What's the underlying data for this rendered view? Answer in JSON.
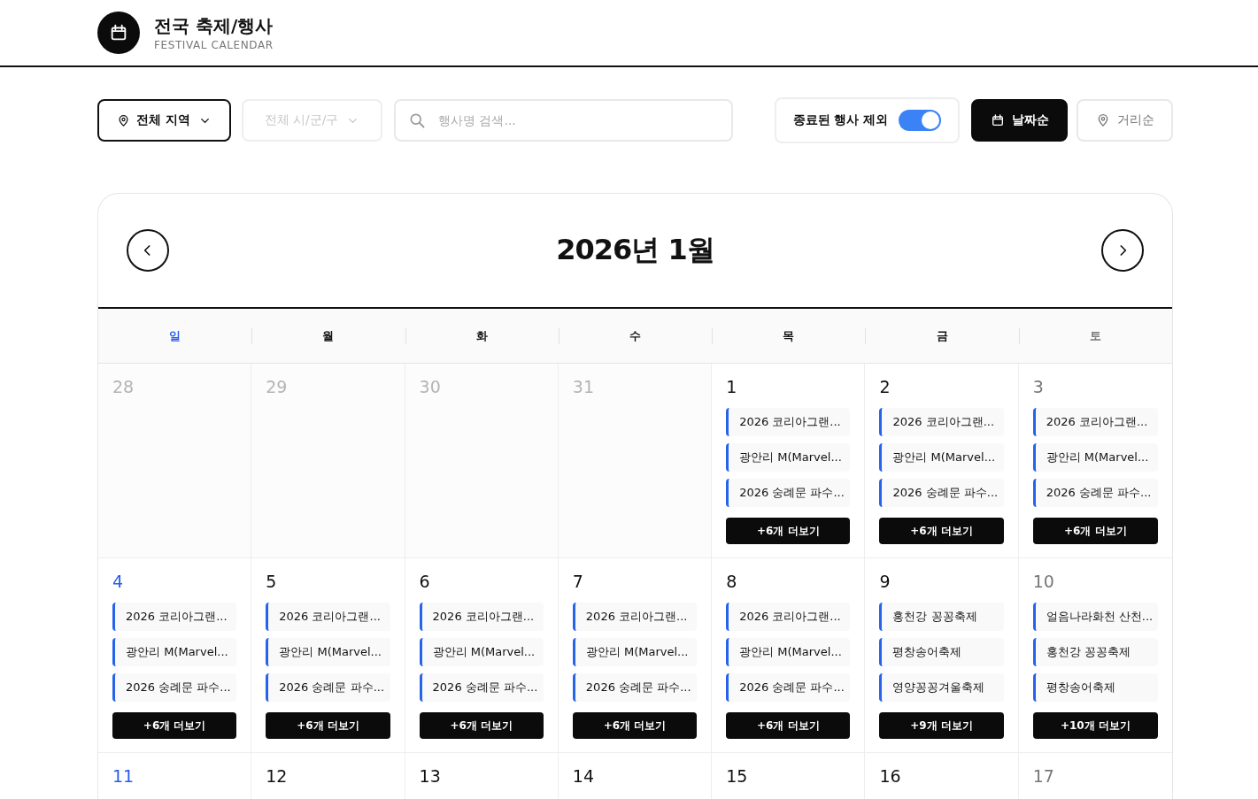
{
  "header": {
    "title": "전국 축제/행사",
    "subtitle": "FESTIVAL CALENDAR"
  },
  "filters": {
    "region": {
      "label": "전체 지역",
      "disabled": false
    },
    "district": {
      "label": "전체 시/군/구",
      "disabled": true
    },
    "search": {
      "placeholder": "행사명 검색..."
    },
    "exclude_ended": {
      "label": "종료된 행사 제외",
      "on": true
    },
    "sort": [
      {
        "label": "날짜순",
        "kind": "date",
        "selected": true
      },
      {
        "label": "거리순",
        "kind": "distance",
        "selected": false
      }
    ]
  },
  "calendar": {
    "title": "2026년 1월",
    "weekdays": [
      {
        "label": "일",
        "kind": "sunday"
      },
      {
        "label": "월",
        "kind": "weekday"
      },
      {
        "label": "화",
        "kind": "weekday"
      },
      {
        "label": "수",
        "kind": "weekday"
      },
      {
        "label": "목",
        "kind": "weekday"
      },
      {
        "label": "금",
        "kind": "weekday"
      },
      {
        "label": "토",
        "kind": "saturday"
      }
    ],
    "weeks": [
      [
        {
          "day": "28",
          "kind": "sunday",
          "outside_month": true
        },
        {
          "day": "29",
          "kind": "weekday",
          "outside_month": true
        },
        {
          "day": "30",
          "kind": "weekday",
          "outside_month": true
        },
        {
          "day": "31",
          "kind": "weekday",
          "outside_month": true
        },
        {
          "day": "1",
          "kind": "weekday",
          "outside_month": false,
          "events": [
            "2026 코리아그랜...",
            "광안리 M(Marvel...",
            "2026 숭례문 파수..."
          ],
          "more": "+6개 더보기"
        },
        {
          "day": "2",
          "kind": "weekday",
          "outside_month": false,
          "events": [
            "2026 코리아그랜...",
            "광안리 M(Marvel...",
            "2026 숭례문 파수..."
          ],
          "more": "+6개 더보기"
        },
        {
          "day": "3",
          "kind": "saturday",
          "outside_month": false,
          "events": [
            "2026 코리아그랜...",
            "광안리 M(Marvel...",
            "2026 숭례문 파수..."
          ],
          "more": "+6개 더보기"
        }
      ],
      [
        {
          "day": "4",
          "kind": "sunday",
          "outside_month": false,
          "events": [
            "2026 코리아그랜...",
            "광안리 M(Marvel...",
            "2026 숭례문 파수..."
          ],
          "more": "+6개 더보기"
        },
        {
          "day": "5",
          "kind": "weekday",
          "outside_month": false,
          "events": [
            "2026 코리아그랜...",
            "광안리 M(Marvel...",
            "2026 숭례문 파수..."
          ],
          "more": "+6개 더보기"
        },
        {
          "day": "6",
          "kind": "weekday",
          "outside_month": false,
          "events": [
            "2026 코리아그랜...",
            "광안리 M(Marvel...",
            "2026 숭례문 파수..."
          ],
          "more": "+6개 더보기"
        },
        {
          "day": "7",
          "kind": "weekday",
          "outside_month": false,
          "events": [
            "2026 코리아그랜...",
            "광안리 M(Marvel...",
            "2026 숭례문 파수..."
          ],
          "more": "+6개 더보기"
        },
        {
          "day": "8",
          "kind": "weekday",
          "outside_month": false,
          "events": [
            "2026 코리아그랜...",
            "광안리 M(Marvel...",
            "2026 숭례문 파수..."
          ],
          "more": "+6개 더보기"
        },
        {
          "day": "9",
          "kind": "weekday",
          "outside_month": false,
          "events": [
            "홍천강 꽁꽁축제",
            "평창송어축제",
            "영양꽁꽁겨울축제"
          ],
          "more": "+9개 더보기"
        },
        {
          "day": "10",
          "kind": "saturday",
          "outside_month": false,
          "events": [
            "얼음나라화천 산천...",
            "홍천강 꽁꽁축제",
            "평창송어축제"
          ],
          "more": "+10개 더보기"
        }
      ],
      [
        {
          "day": "11",
          "kind": "sunday",
          "outside_month": false
        },
        {
          "day": "12",
          "kind": "weekday",
          "outside_month": false
        },
        {
          "day": "13",
          "kind": "weekday",
          "outside_month": false
        },
        {
          "day": "14",
          "kind": "weekday",
          "outside_month": false
        },
        {
          "day": "15",
          "kind": "weekday",
          "outside_month": false
        },
        {
          "day": "16",
          "kind": "weekday",
          "outside_month": false
        },
        {
          "day": "17",
          "kind": "saturday",
          "outside_month": false
        }
      ]
    ]
  }
}
